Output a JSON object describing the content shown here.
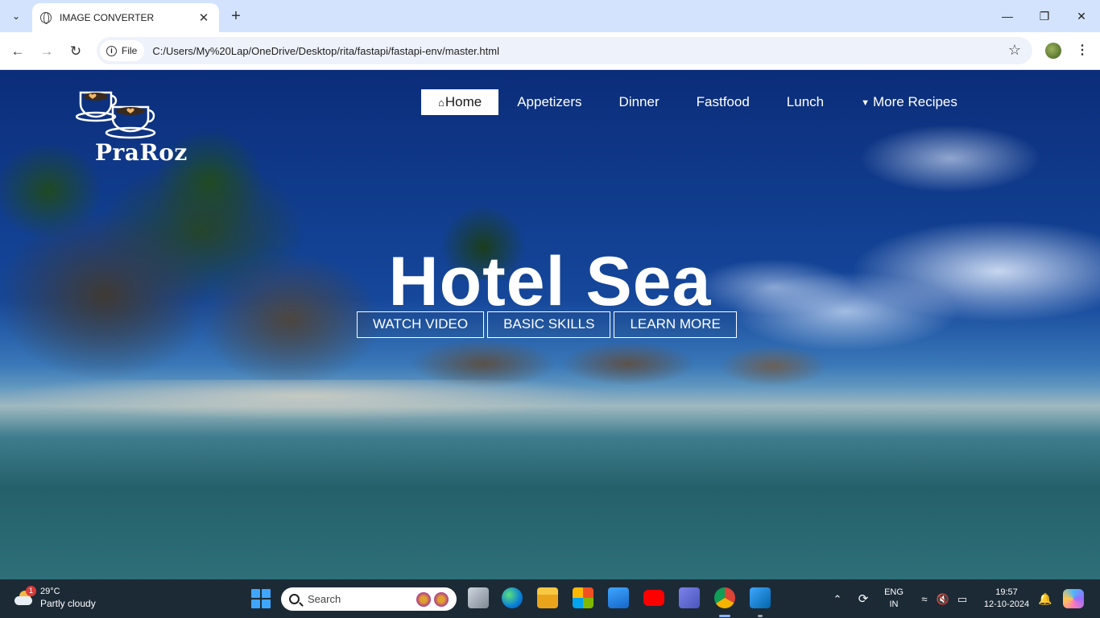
{
  "browser": {
    "tab_title": "IMAGE CONVERTER",
    "chip_label": "File",
    "url": "C:/Users/My%20Lap/OneDrive/Desktop/rita/fastapi/fastapi-env/master.html",
    "new_tab_glyph": "+",
    "close_tab_glyph": "✕",
    "back_glyph": "←",
    "forward_glyph": "→",
    "reload_glyph": "↻",
    "star_glyph": "☆",
    "menu_glyph": "⋮",
    "minimize_glyph": "—",
    "maximize_glyph": "❐",
    "close_glyph": "✕",
    "tab_search_glyph": "⌄"
  },
  "site": {
    "brand": "PraRoz",
    "nav": [
      {
        "label": "Home",
        "icon": "home-icon",
        "active": true
      },
      {
        "label": "Appetizers"
      },
      {
        "label": "Dinner"
      },
      {
        "label": "Fastfood"
      },
      {
        "label": "Lunch"
      },
      {
        "label": "More Recipes",
        "icon": "caret-down-icon"
      }
    ],
    "hero_title": "Hotel Sea",
    "hero_buttons": [
      "WATCH VIDEO",
      "BASIC SKILLS",
      "LEARN MORE"
    ]
  },
  "taskbar": {
    "weather_temp": "29°C",
    "weather_condition": "Partly cloudy",
    "weather_badge": "1",
    "search_placeholder": "Search",
    "lang_top": "ENG",
    "lang_bottom": "IN",
    "time": "19:57",
    "date": "12-10-2024",
    "apps": [
      "task-view",
      "edge",
      "file-explorer",
      "microsoft-store",
      "mail",
      "youtube",
      "teams",
      "chrome",
      "vscode"
    ]
  },
  "colors": {
    "tabbar_bg": "#d3e3fd",
    "taskbar_bg": "#1c2a36",
    "nav_active_bg": "#ffffff",
    "hero_text": "#ffffff"
  }
}
